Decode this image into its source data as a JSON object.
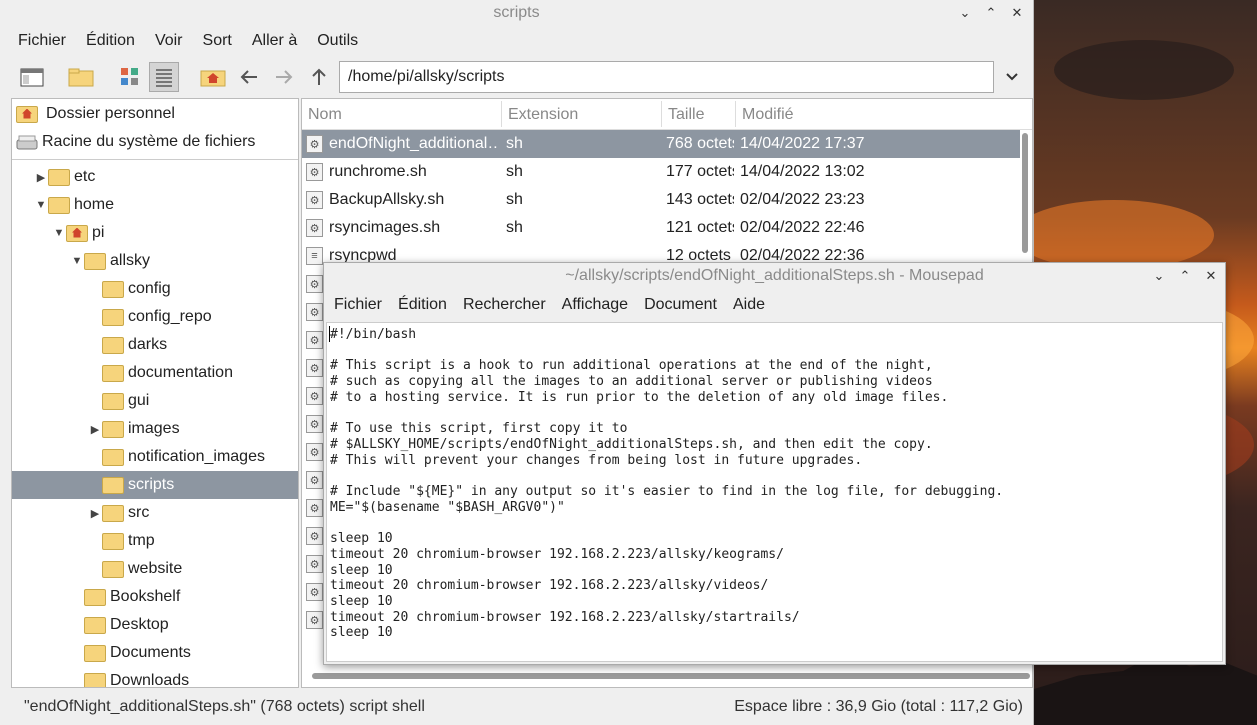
{
  "filemanager": {
    "title": "scripts",
    "window_buttons": [
      "⌄",
      "⌃",
      "✕"
    ],
    "menu": [
      "Fichier",
      "Édition",
      "Voir",
      "Sort",
      "Aller à",
      "Outils"
    ],
    "address": "/home/pi/allsky/scripts",
    "places": [
      "Dossier personnel",
      "Racine du système de fichiers"
    ],
    "tree": [
      {
        "label": "etc",
        "arrow": "▶",
        "depth": 0
      },
      {
        "label": "home",
        "arrow": "▼",
        "depth": 0
      },
      {
        "label": "pi",
        "arrow": "▼",
        "depth": 1,
        "home": true
      },
      {
        "label": "allsky",
        "arrow": "▼",
        "depth": 2
      },
      {
        "label": "config",
        "arrow": "",
        "depth": 3
      },
      {
        "label": "config_repo",
        "arrow": "",
        "depth": 3
      },
      {
        "label": "darks",
        "arrow": "",
        "depth": 3
      },
      {
        "label": "documentation",
        "arrow": "",
        "depth": 3
      },
      {
        "label": "gui",
        "arrow": "",
        "depth": 3
      },
      {
        "label": "images",
        "arrow": "▶",
        "depth": 3
      },
      {
        "label": "notification_images",
        "arrow": "",
        "depth": 3
      },
      {
        "label": "scripts",
        "arrow": "",
        "depth": 3,
        "selected": true
      },
      {
        "label": "src",
        "arrow": "▶",
        "depth": 3
      },
      {
        "label": "tmp",
        "arrow": "",
        "depth": 3
      },
      {
        "label": "website",
        "arrow": "",
        "depth": 3
      },
      {
        "label": "Bookshelf",
        "arrow": "",
        "depth": 2
      },
      {
        "label": "Desktop",
        "arrow": "",
        "depth": 2
      },
      {
        "label": "Documents",
        "arrow": "",
        "depth": 2
      },
      {
        "label": "Downloads",
        "arrow": "",
        "depth": 2
      }
    ],
    "columns": [
      "Nom",
      "Extension",
      "Taille",
      "Modifié"
    ],
    "files": [
      {
        "name": "endOfNight_additional…",
        "ext": "sh",
        "size": "768 octets",
        "modified": "14/04/2022 17:37",
        "selected": true
      },
      {
        "name": "runchrome.sh",
        "ext": "sh",
        "size": "177 octets",
        "modified": "14/04/2022 13:02"
      },
      {
        "name": "BackupAllsky.sh",
        "ext": "sh",
        "size": "143 octets",
        "modified": "02/04/2022 23:23"
      },
      {
        "name": "rsyncimages.sh",
        "ext": "sh",
        "size": "121 octets",
        "modified": "02/04/2022 22:46"
      },
      {
        "name": "rsyncpwd",
        "ext": "",
        "size": "12 octets",
        "modified": "02/04/2022 22:36"
      }
    ],
    "status_left": "\"endOfNight_additionalSteps.sh\" (768 octets) script shell",
    "status_right": "Espace libre : 36,9 Gio (total : 117,2 Gio)"
  },
  "mousepad": {
    "title": "~/allsky/scripts/endOfNight_additionalSteps.sh - Mousepad",
    "menu": [
      "Fichier",
      "Édition",
      "Rechercher",
      "Affichage",
      "Document",
      "Aide"
    ],
    "content": "#!/bin/bash\n\n# This script is a hook to run additional operations at the end of the night,\n# such as copying all the images to an additional server or publishing videos\n# to a hosting service. It is run prior to the deletion of any old image files.\n\n# To use this script, first copy it to\n# $ALLSKY_HOME/scripts/endOfNight_additionalSteps.sh, and then edit the copy.\n# This will prevent your changes from being lost in future upgrades.\n\n# Include \"${ME}\" in any output so it's easier to find in the log file, for debugging.\nME=\"$(basename \"$BASH_ARGV0\")\"\n\nsleep 10\ntimeout 20 chromium-browser 192.168.2.223/allsky/keograms/\nsleep 10\ntimeout 20 chromium-browser 192.168.2.223/allsky/videos/\nsleep 10\ntimeout 20 chromium-browser 192.168.2.223/allsky/startrails/\nsleep 10"
  }
}
